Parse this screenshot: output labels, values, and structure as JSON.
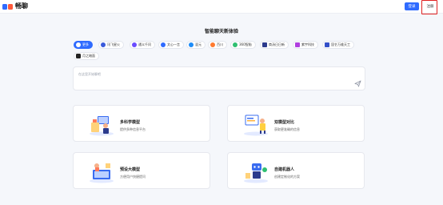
{
  "header": {
    "brand": "畅聊",
    "login_label": "登录",
    "register_label": "注册"
  },
  "title": "智能聊天新体验",
  "models": [
    {
      "label": "更多",
      "color": "#2f6bff",
      "active": true
    },
    {
      "label": "讯飞星火",
      "color": "#3b5bdb"
    },
    {
      "label": "通义千问",
      "color": "#6a4cff"
    },
    {
      "label": "文心一言",
      "color": "#2f6bff"
    },
    {
      "label": "混元",
      "color": "#1d8cf8"
    },
    {
      "label": "百川",
      "color": "#ff7a2f"
    },
    {
      "label": "360智脑",
      "color": "#2fbf71"
    },
    {
      "label": "商汤日日新",
      "color": "#2b3a8c"
    },
    {
      "label": "紫宇科技",
      "color": "#b040e0"
    },
    {
      "label": "昆仑万维天工",
      "color": "#3450c8"
    },
    {
      "label": "月之暗面",
      "color": "#222222"
    }
  ],
  "input": {
    "placeholder": "在这里开始聊吧"
  },
  "cards": [
    {
      "title": "多科学模型",
      "subtitle": "提供多种信息平台"
    },
    {
      "title": "双模型对比",
      "subtitle": "获取更准确的信息"
    },
    {
      "title": "预设大模型",
      "subtitle": "方便用户快捷提问"
    },
    {
      "title": "自建机器人",
      "subtitle": "创建定制化的方案"
    }
  ],
  "colors": {
    "accent": "#2f6bff",
    "highlight_border": "#e02020",
    "background": "#f5f7fb"
  }
}
